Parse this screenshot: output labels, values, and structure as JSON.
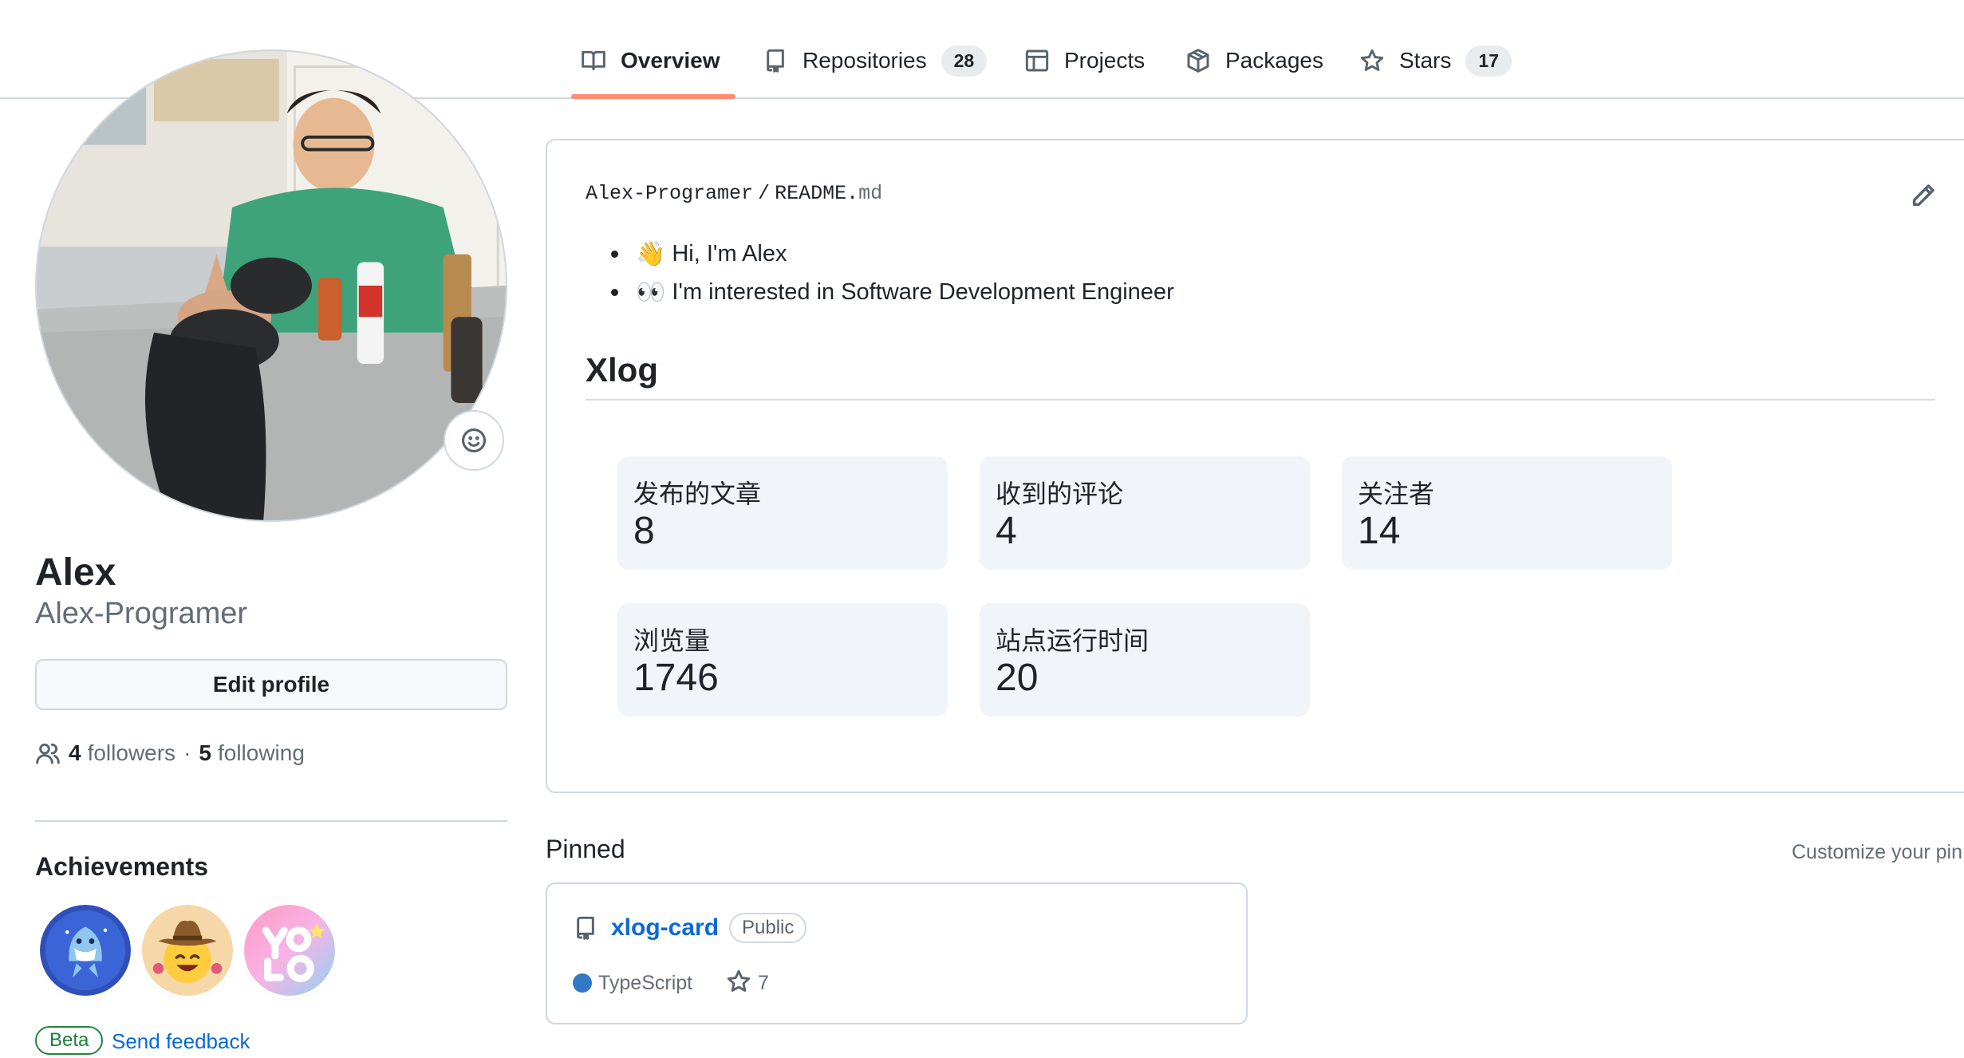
{
  "nav": {
    "tabs": [
      {
        "label": "Overview",
        "icon": "book-icon",
        "active": true
      },
      {
        "label": "Repositories",
        "icon": "repo-icon",
        "count": "28"
      },
      {
        "label": "Projects",
        "icon": "table-icon"
      },
      {
        "label": "Packages",
        "icon": "package-icon"
      },
      {
        "label": "Stars",
        "icon": "star-icon",
        "count": "17"
      }
    ],
    "active_color": "#fd8c73"
  },
  "profile": {
    "name": "Alex",
    "login": "Alex-Programer",
    "edit_label": "Edit profile",
    "followers_count": "4",
    "followers_label": "followers",
    "separator": "·",
    "following_count": "5",
    "following_label": "following",
    "achievements_title": "Achievements",
    "achievements": [
      {
        "icon": "shark-badge-icon"
      },
      {
        "icon": "cowboy-badge-icon"
      },
      {
        "icon": "yolo-badge-icon"
      }
    ],
    "beta_label": "Beta",
    "feedback_label": "Send feedback"
  },
  "readme": {
    "owner": "Alex-Programer",
    "separator": "/",
    "file_base": "README.",
    "file_ext": "md",
    "items": [
      {
        "emoji": "👋",
        "text": "Hi, I'm Alex"
      },
      {
        "emoji": "👀",
        "text": "I'm interested in Software Development Engineer"
      }
    ],
    "heading": "Xlog",
    "stats": [
      {
        "label": "发布的文章",
        "value": "8"
      },
      {
        "label": "收到的评论",
        "value": "4"
      },
      {
        "label": "关注者",
        "value": "14"
      },
      {
        "label": "浏览量",
        "value": "1746"
      },
      {
        "label": "站点运行时间",
        "value": "20"
      }
    ]
  },
  "pinned": {
    "title": "Pinned",
    "customize_label": "Customize your pin",
    "repos": [
      {
        "name": "xlog-card",
        "visibility": "Public",
        "language": "TypeScript",
        "language_color": "#3178c6",
        "stars": "7"
      }
    ]
  }
}
